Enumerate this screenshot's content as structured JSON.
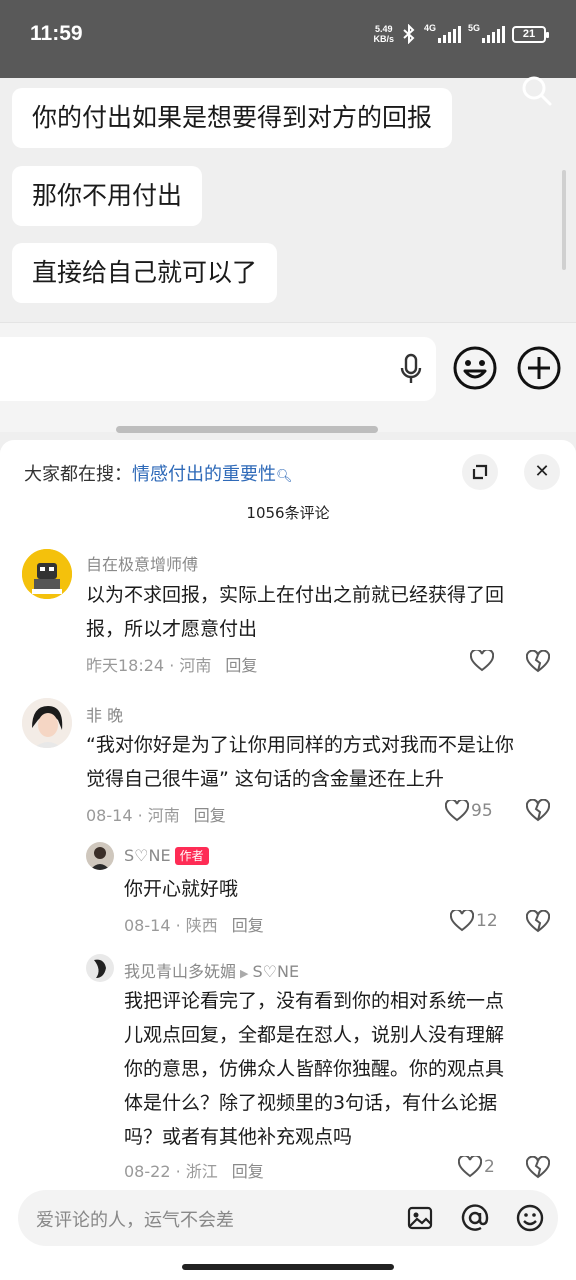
{
  "status_bar": {
    "time": "11:59",
    "net_speed_value": "5.49",
    "net_speed_unit": "KB/s",
    "signal1_label": "4G",
    "signal2_label": "5G",
    "battery": "21"
  },
  "video": {
    "chat_lines": [
      "你的付出如果是想要得到对方的回报",
      "那你不用付出",
      "直接给自己就可以了"
    ],
    "progress": 0.0
  },
  "panel": {
    "search_prefix": "大家都在搜：",
    "search_keyword": "情感付出的重要性",
    "comment_count": "1056条评论",
    "reply_label": "回复"
  },
  "comments": [
    {
      "username": "自在极意增师傅",
      "text_lines": [
        "以为不求回报，实际上在付出之前就已经获得了回",
        "报，所以才愿意付出"
      ],
      "time": "昨天18:24",
      "location": "河南",
      "likes": ""
    },
    {
      "username": "非 晚",
      "text_lines": [
        "“我对你好是为了让你用同样的方式对我而不是让你",
        "觉得自己很牛逼” 这句话的含金量还在上升"
      ],
      "time": "08-14",
      "location": "河南",
      "likes": "95"
    }
  ],
  "replies": [
    {
      "username": "S♡NE",
      "badge": "作者",
      "text_lines": [
        "你开心就好哦"
      ],
      "time": "08-14",
      "location": "陕西",
      "likes": "12"
    },
    {
      "username": "我见青山多妩媚",
      "reply_to": "S♡NE",
      "text_lines": [
        "我把评论看完了，没有看到你的相对系统一点",
        "儿观点回复，全都是在怼人，说别人没有理解",
        "你的意思，仿佛众人皆醉你独醒。你的观点具",
        "体是什么？除了视频里的3句话，有什么论据",
        "吗？或者有其他补充观点吗"
      ],
      "time": "08-22",
      "location": "浙江",
      "likes": "2"
    }
  ],
  "bottom_input": {
    "placeholder": "爱评论的人，运气不会差"
  },
  "colors": {
    "accent_link": "#2f6ab8",
    "author_badge": "#fe2c55"
  }
}
